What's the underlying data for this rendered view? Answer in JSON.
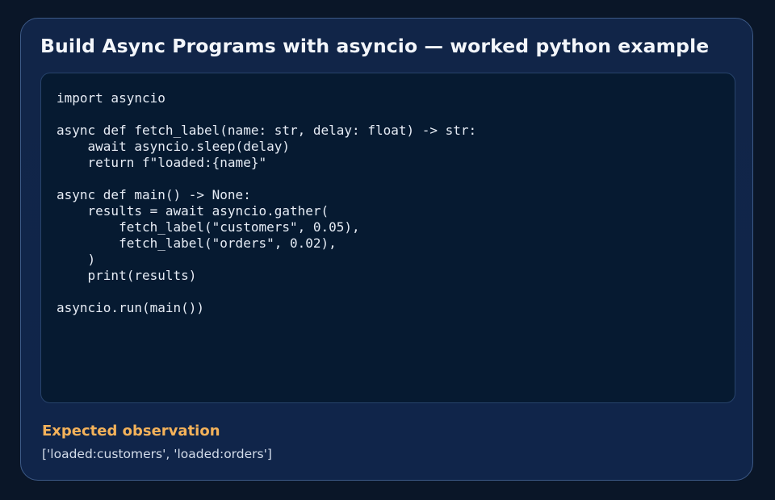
{
  "title": "Build Async Programs with asyncio — worked python example",
  "code": {
    "language": "python",
    "text": "import asyncio\n\nasync def fetch_label(name: str, delay: float) -> str:\n    await asyncio.sleep(delay)\n    return f\"loaded:{name}\"\n\nasync def main() -> None:\n    results = await asyncio.gather(\n        fetch_label(\"customers\", 0.05),\n        fetch_label(\"orders\", 0.02),\n    )\n    print(results)\n\nasyncio.run(main())"
  },
  "observation": {
    "heading": "Expected observation",
    "text": "['loaded:customers', 'loaded:orders']"
  },
  "colors": {
    "page_background": "#0a1628",
    "card_background": "#112548",
    "card_border": "#3d5a87",
    "code_background": "#061a31",
    "heading_accent": "#f4b25a"
  }
}
